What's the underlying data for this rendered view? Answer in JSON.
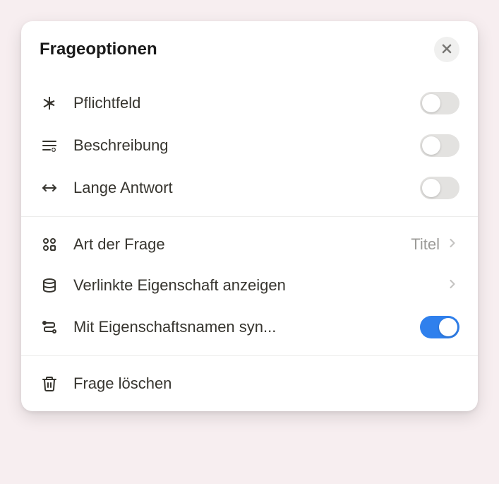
{
  "header": {
    "title": "Frageoptionen"
  },
  "section1": {
    "required": {
      "label": "Pflichtfeld",
      "on": false
    },
    "description": {
      "label": "Beschreibung",
      "on": false
    },
    "longAnswer": {
      "label": "Lange Antwort",
      "on": false
    }
  },
  "section2": {
    "questionType": {
      "label": "Art der Frage",
      "value": "Titel"
    },
    "linkedProperty": {
      "label": "Verlinkte Eigenschaft anzeigen"
    },
    "syncName": {
      "label": "Mit Eigenschaftsnamen syn...",
      "on": true
    }
  },
  "section3": {
    "delete": {
      "label": "Frage löschen"
    }
  }
}
